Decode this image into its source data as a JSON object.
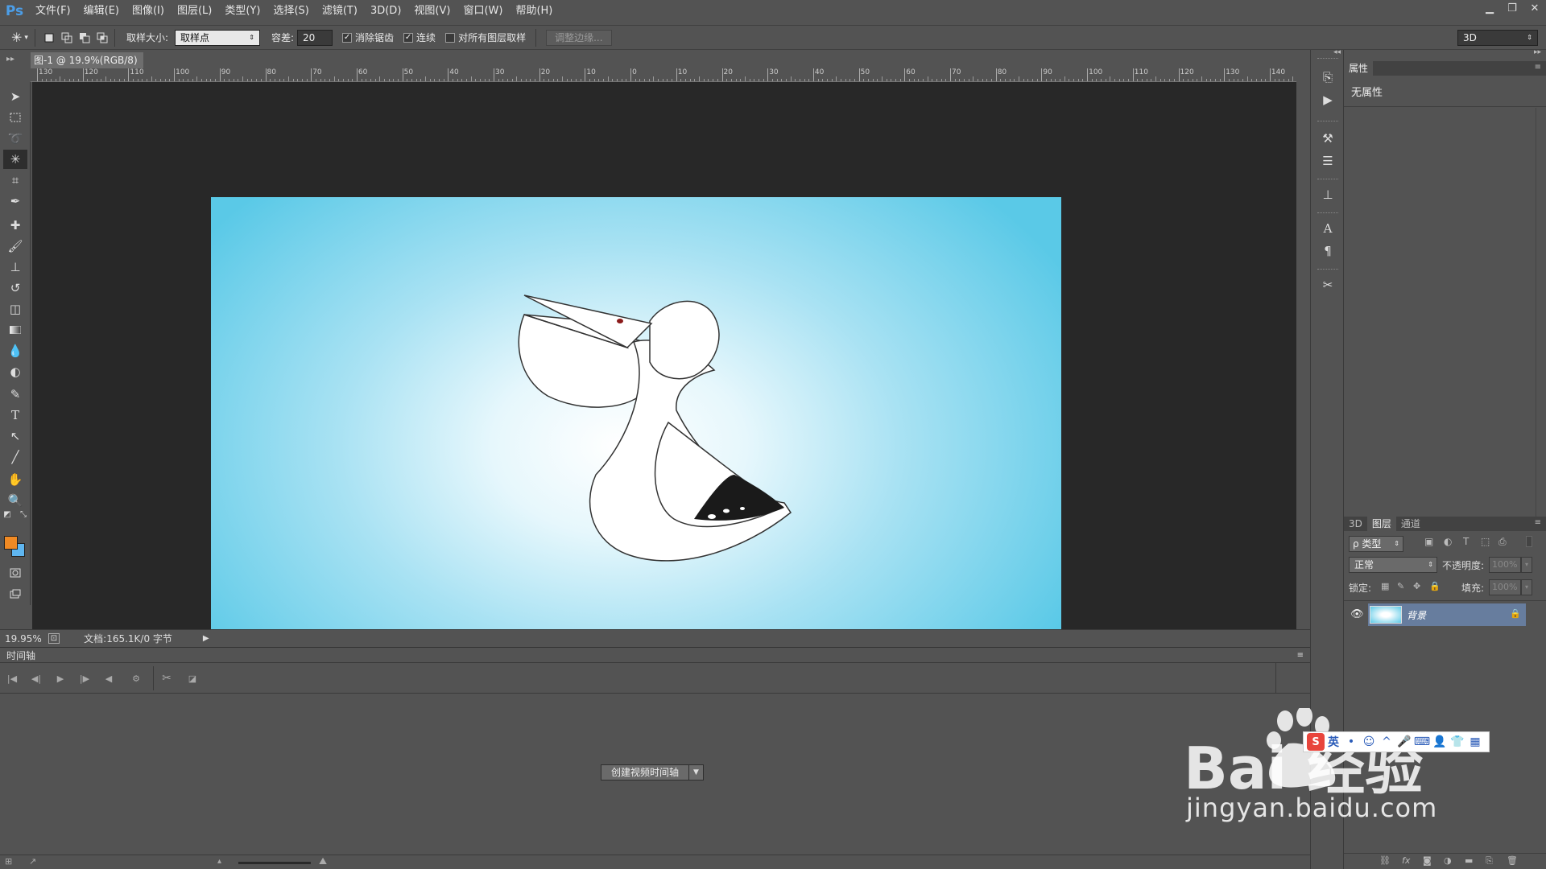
{
  "app": {
    "logo": "Ps"
  },
  "menu": [
    "文件(F)",
    "编辑(E)",
    "图像(I)",
    "图层(L)",
    "类型(Y)",
    "选择(S)",
    "滤镜(T)",
    "3D(D)",
    "视图(V)",
    "窗口(W)",
    "帮助(H)"
  ],
  "window_controls": {
    "minimize": "▁",
    "restore": "❐",
    "close": "✕"
  },
  "options": {
    "sample_size_label": "取样大小:",
    "sample_size_value": "取样点",
    "tolerance_label": "容差:",
    "tolerance_value": "20",
    "antialias_label": "消除锯齿",
    "antialias_checked": true,
    "contiguous_label": "连续",
    "contiguous_checked": true,
    "sample_all_label": "对所有图层取样",
    "sample_all_checked": false,
    "refine_edge_label": "调整边缘...",
    "workspace_value": "3D"
  },
  "document": {
    "tab_title": "图-1 @ 19.9%(RGB/8)",
    "tab_close": "×"
  },
  "ruler": {
    "ticks": [
      "130",
      "120",
      "110",
      "100",
      "90",
      "80",
      "70",
      "60",
      "50",
      "40",
      "30",
      "20",
      "10",
      "0",
      "10",
      "20",
      "30",
      "40",
      "50",
      "60",
      "70",
      "80",
      "90",
      "100",
      "110",
      "120",
      "130",
      "140"
    ]
  },
  "status": {
    "zoom": "19.95%",
    "doc_info": "文档:165.1K/0 字节"
  },
  "timeline": {
    "title": "时间轴",
    "create_button": "创建视频时间轴"
  },
  "properties": {
    "tab": "属性",
    "content": "无属性"
  },
  "layers_panel": {
    "tabs": [
      "3D",
      "图层",
      "通道"
    ],
    "active_tab": "图层",
    "filter_label": "ρ 类型",
    "blend_mode": "正常",
    "opacity_label": "不透明度:",
    "opacity_value": "100%",
    "lock_label": "锁定:",
    "fill_label": "填充:",
    "fill_value": "100%",
    "layers": [
      {
        "name": "背景",
        "locked": true,
        "visible": true
      }
    ]
  },
  "ime": {
    "lang": "英"
  },
  "watermark": {
    "brand": "Bai 经验",
    "url": "jingyan.baidu.com"
  },
  "colors": {
    "foreground": "#f08a24",
    "background": "#5fb6f0",
    "canvas_edge": "#5ac9e7",
    "canvas_center": "#ffffff"
  }
}
